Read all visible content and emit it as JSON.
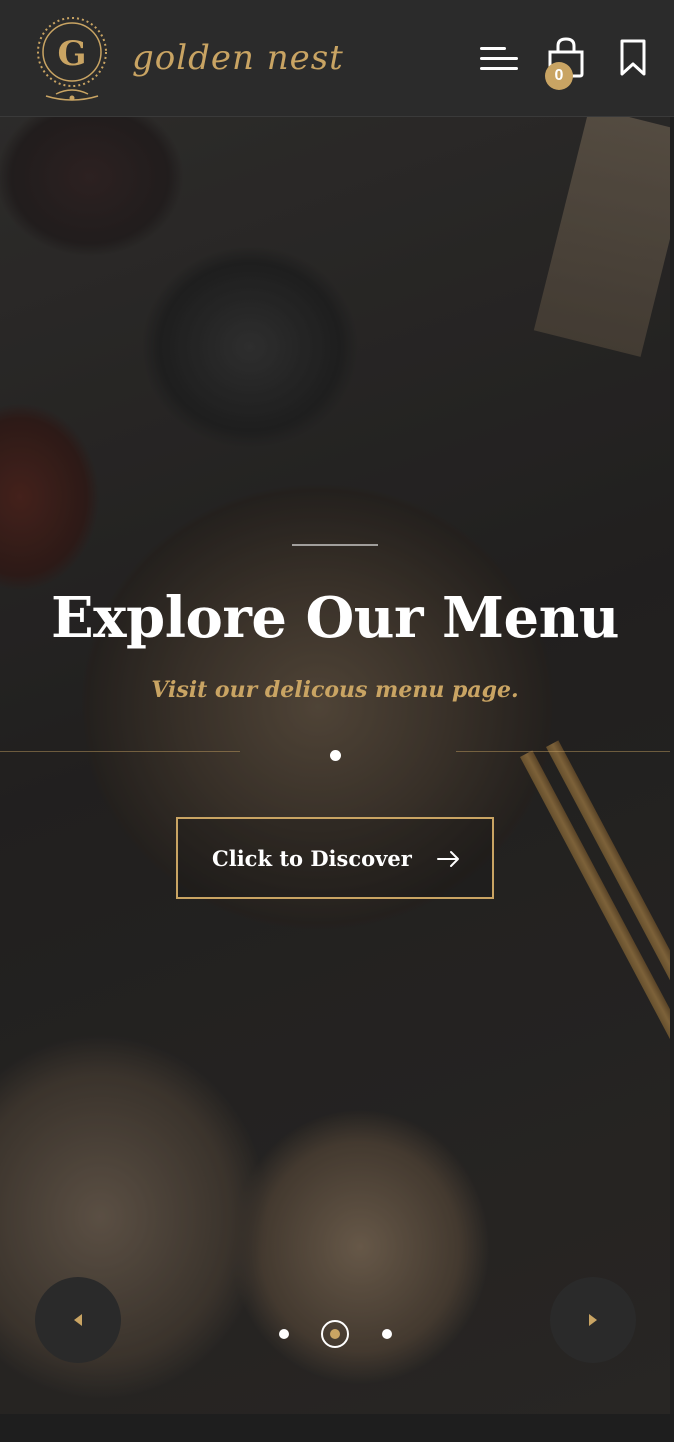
{
  "header": {
    "brand_name": "golden nest",
    "cart_count": "0",
    "accent_color": "#c9a463",
    "icons": [
      "logo-emblem",
      "menu-icon",
      "shopping-bag-icon",
      "bookmark-icon"
    ]
  },
  "hero": {
    "title": "Explore Our Menu",
    "subtitle": "Visit our delicous menu page.",
    "cta_label": "Click to Discover",
    "cta_icon": "arrow-right-icon",
    "prev_icon": "caret-left-icon",
    "next_icon": "caret-right-icon",
    "slides_total": 3,
    "active_slide": 2
  }
}
